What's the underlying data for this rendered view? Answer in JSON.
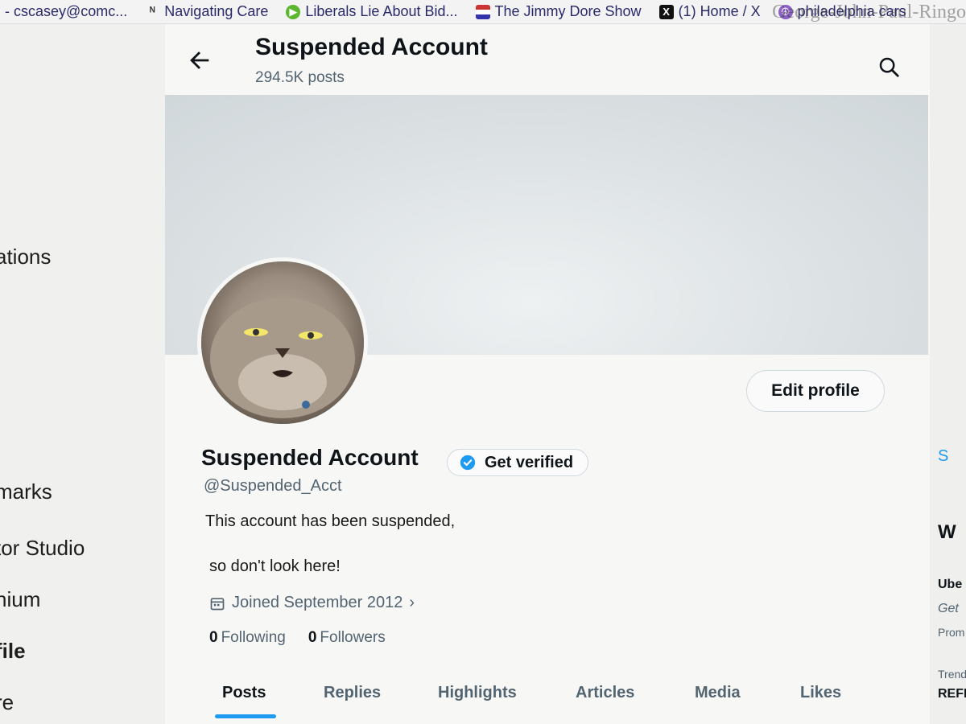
{
  "bookmarks": [
    {
      "label": "- cscasey@comc...",
      "icon": "mail-icon"
    },
    {
      "label": "Navigating Care",
      "icon": "n-icon"
    },
    {
      "label": "Liberals Lie About Bid...",
      "icon": "play-icon"
    },
    {
      "label": "The Jimmy Dore Show",
      "icon": "flag-icon"
    },
    {
      "label": "(1) Home / X",
      "icon": "x-icon"
    },
    {
      "label": "philadelphia cars",
      "icon": "peace-icon"
    }
  ],
  "faint_title": "George-John-Paul-Ringo",
  "leftnav": {
    "items": [
      {
        "label": "ations"
      },
      {
        "label": "marks"
      },
      {
        "label": "tor Studio"
      },
      {
        "label": "nium"
      },
      {
        "label": "file"
      },
      {
        "label": "re"
      }
    ]
  },
  "header": {
    "title": "Suspended Account",
    "post_count": "294.5K posts"
  },
  "profile": {
    "display_name": "Suspended Account",
    "verify_label": "Get verified",
    "handle": "@Suspended_Acct",
    "bio_line1": "This account has been suspended,",
    "bio_line2": "so don't look here!",
    "joined": "Joined September 2012",
    "following_count": "0",
    "following_label": "Following",
    "followers_count": "0",
    "followers_label": "Followers",
    "edit_label": "Edit profile"
  },
  "tabs": [
    {
      "label": "Posts",
      "active": true
    },
    {
      "label": "Replies",
      "active": false
    },
    {
      "label": "Highlights",
      "active": false
    },
    {
      "label": "Articles",
      "active": false
    },
    {
      "label": "Media",
      "active": false
    },
    {
      "label": "Likes",
      "active": false
    }
  ],
  "rightcol": {
    "items": [
      "S",
      "W",
      "Ube",
      "Get",
      "Prom",
      "Trend",
      "REFL"
    ]
  },
  "colors": {
    "accent": "#1d9bf0",
    "secondary_text": "#536471",
    "banner": "#d6dcdf"
  }
}
